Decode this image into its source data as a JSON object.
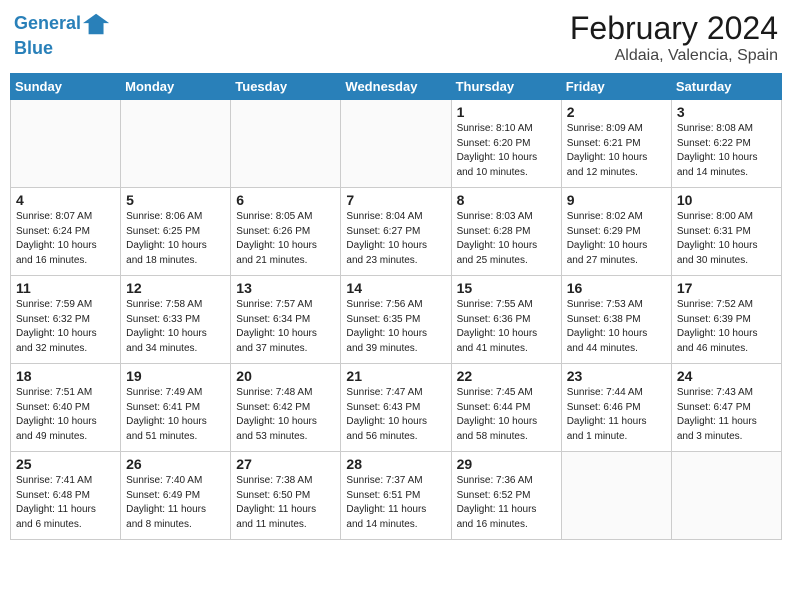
{
  "header": {
    "logo_line1": "General",
    "logo_line2": "Blue",
    "month": "February 2024",
    "location": "Aldaia, Valencia, Spain"
  },
  "weekdays": [
    "Sunday",
    "Monday",
    "Tuesday",
    "Wednesday",
    "Thursday",
    "Friday",
    "Saturday"
  ],
  "weeks": [
    [
      {
        "day": "",
        "info": ""
      },
      {
        "day": "",
        "info": ""
      },
      {
        "day": "",
        "info": ""
      },
      {
        "day": "",
        "info": ""
      },
      {
        "day": "1",
        "info": "Sunrise: 8:10 AM\nSunset: 6:20 PM\nDaylight: 10 hours\nand 10 minutes."
      },
      {
        "day": "2",
        "info": "Sunrise: 8:09 AM\nSunset: 6:21 PM\nDaylight: 10 hours\nand 12 minutes."
      },
      {
        "day": "3",
        "info": "Sunrise: 8:08 AM\nSunset: 6:22 PM\nDaylight: 10 hours\nand 14 minutes."
      }
    ],
    [
      {
        "day": "4",
        "info": "Sunrise: 8:07 AM\nSunset: 6:24 PM\nDaylight: 10 hours\nand 16 minutes."
      },
      {
        "day": "5",
        "info": "Sunrise: 8:06 AM\nSunset: 6:25 PM\nDaylight: 10 hours\nand 18 minutes."
      },
      {
        "day": "6",
        "info": "Sunrise: 8:05 AM\nSunset: 6:26 PM\nDaylight: 10 hours\nand 21 minutes."
      },
      {
        "day": "7",
        "info": "Sunrise: 8:04 AM\nSunset: 6:27 PM\nDaylight: 10 hours\nand 23 minutes."
      },
      {
        "day": "8",
        "info": "Sunrise: 8:03 AM\nSunset: 6:28 PM\nDaylight: 10 hours\nand 25 minutes."
      },
      {
        "day": "9",
        "info": "Sunrise: 8:02 AM\nSunset: 6:29 PM\nDaylight: 10 hours\nand 27 minutes."
      },
      {
        "day": "10",
        "info": "Sunrise: 8:00 AM\nSunset: 6:31 PM\nDaylight: 10 hours\nand 30 minutes."
      }
    ],
    [
      {
        "day": "11",
        "info": "Sunrise: 7:59 AM\nSunset: 6:32 PM\nDaylight: 10 hours\nand 32 minutes."
      },
      {
        "day": "12",
        "info": "Sunrise: 7:58 AM\nSunset: 6:33 PM\nDaylight: 10 hours\nand 34 minutes."
      },
      {
        "day": "13",
        "info": "Sunrise: 7:57 AM\nSunset: 6:34 PM\nDaylight: 10 hours\nand 37 minutes."
      },
      {
        "day": "14",
        "info": "Sunrise: 7:56 AM\nSunset: 6:35 PM\nDaylight: 10 hours\nand 39 minutes."
      },
      {
        "day": "15",
        "info": "Sunrise: 7:55 AM\nSunset: 6:36 PM\nDaylight: 10 hours\nand 41 minutes."
      },
      {
        "day": "16",
        "info": "Sunrise: 7:53 AM\nSunset: 6:38 PM\nDaylight: 10 hours\nand 44 minutes."
      },
      {
        "day": "17",
        "info": "Sunrise: 7:52 AM\nSunset: 6:39 PM\nDaylight: 10 hours\nand 46 minutes."
      }
    ],
    [
      {
        "day": "18",
        "info": "Sunrise: 7:51 AM\nSunset: 6:40 PM\nDaylight: 10 hours\nand 49 minutes."
      },
      {
        "day": "19",
        "info": "Sunrise: 7:49 AM\nSunset: 6:41 PM\nDaylight: 10 hours\nand 51 minutes."
      },
      {
        "day": "20",
        "info": "Sunrise: 7:48 AM\nSunset: 6:42 PM\nDaylight: 10 hours\nand 53 minutes."
      },
      {
        "day": "21",
        "info": "Sunrise: 7:47 AM\nSunset: 6:43 PM\nDaylight: 10 hours\nand 56 minutes."
      },
      {
        "day": "22",
        "info": "Sunrise: 7:45 AM\nSunset: 6:44 PM\nDaylight: 10 hours\nand 58 minutes."
      },
      {
        "day": "23",
        "info": "Sunrise: 7:44 AM\nSunset: 6:46 PM\nDaylight: 11 hours\nand 1 minute."
      },
      {
        "day": "24",
        "info": "Sunrise: 7:43 AM\nSunset: 6:47 PM\nDaylight: 11 hours\nand 3 minutes."
      }
    ],
    [
      {
        "day": "25",
        "info": "Sunrise: 7:41 AM\nSunset: 6:48 PM\nDaylight: 11 hours\nand 6 minutes."
      },
      {
        "day": "26",
        "info": "Sunrise: 7:40 AM\nSunset: 6:49 PM\nDaylight: 11 hours\nand 8 minutes."
      },
      {
        "day": "27",
        "info": "Sunrise: 7:38 AM\nSunset: 6:50 PM\nDaylight: 11 hours\nand 11 minutes."
      },
      {
        "day": "28",
        "info": "Sunrise: 7:37 AM\nSunset: 6:51 PM\nDaylight: 11 hours\nand 14 minutes."
      },
      {
        "day": "29",
        "info": "Sunrise: 7:36 AM\nSunset: 6:52 PM\nDaylight: 11 hours\nand 16 minutes."
      },
      {
        "day": "",
        "info": ""
      },
      {
        "day": "",
        "info": ""
      }
    ]
  ]
}
